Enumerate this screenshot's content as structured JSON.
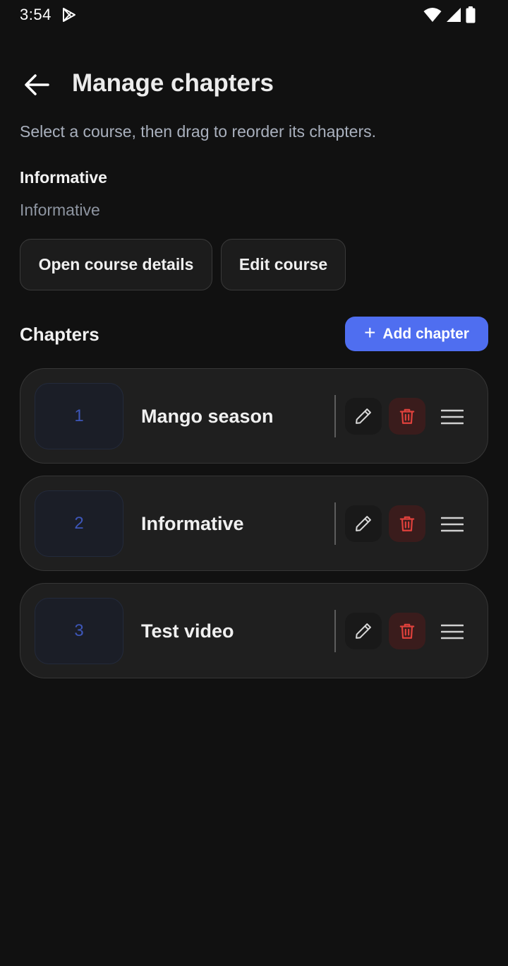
{
  "status_bar": {
    "time": "3:54"
  },
  "header": {
    "title": "Manage chapters"
  },
  "subtitle": "Select a course, then drag to reorder its chapters.",
  "course": {
    "name": "Informative",
    "description": "Informative"
  },
  "actions": {
    "open_details_label": "Open course details",
    "edit_course_label": "Edit course"
  },
  "chapters_section": {
    "title": "Chapters",
    "add_label": "Add chapter",
    "items": [
      {
        "number": "1",
        "title": "Mango season"
      },
      {
        "number": "2",
        "title": "Informative"
      },
      {
        "number": "3",
        "title": "Test video"
      }
    ]
  },
  "colors": {
    "background": "#111111",
    "card": "#1f1f1f",
    "accent": "#4f6ef0",
    "danger": "#e0413c",
    "number": "#3d56b8"
  },
  "icons": [
    "play-store-icon",
    "wifi-icon",
    "signal-icon",
    "battery-icon",
    "back-arrow-icon",
    "plus-icon",
    "pencil-icon",
    "trash-icon",
    "drag-handle-icon"
  ]
}
